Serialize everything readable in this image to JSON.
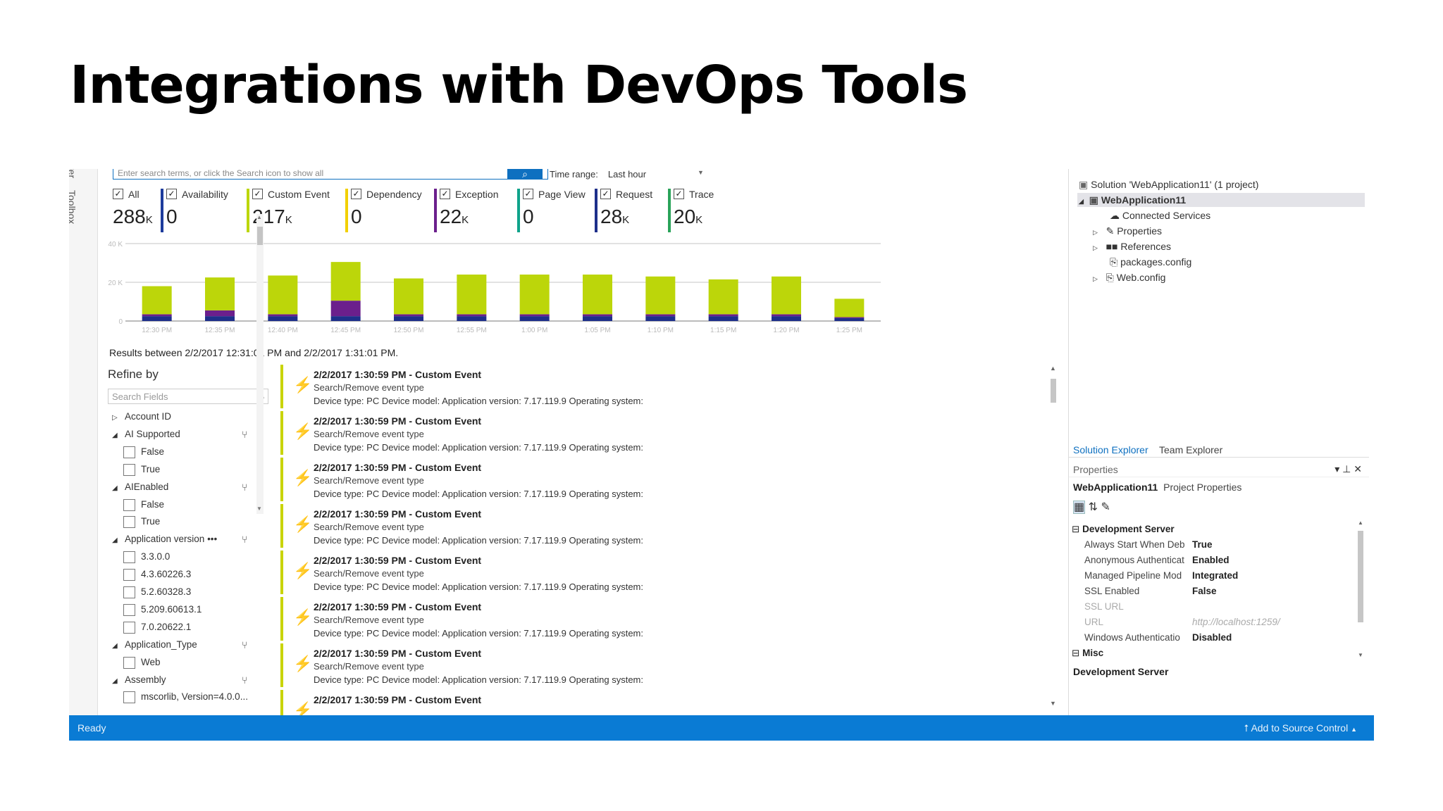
{
  "slide": {
    "title": "Integrations with DevOps Tools"
  },
  "toolbox": {
    "label": "Toolbox",
    "ref_label": "rer"
  },
  "search": {
    "placeholder": "Enter search terms, or click the Search icon to show all",
    "button_icon": "search-icon"
  },
  "time_range": {
    "label": "Time range:",
    "value": "Last hour"
  },
  "filters": [
    {
      "label": "All",
      "count": "288",
      "unit": "K",
      "color": "#ffffff",
      "checked": true
    },
    {
      "label": "Availability",
      "count": "0",
      "unit": "",
      "color": "#1d3b9c",
      "checked": true
    },
    {
      "label": "Custom Event",
      "count": "217",
      "unit": "K",
      "color": "#bcd60a",
      "checked": true
    },
    {
      "label": "Dependency",
      "count": "0",
      "unit": "",
      "color": "#f2d000",
      "checked": true
    },
    {
      "label": "Exception",
      "count": "22",
      "unit": "K",
      "color": "#6b1f8c",
      "checked": true
    },
    {
      "label": "Page View",
      "count": "0",
      "unit": "",
      "color": "#0fa38a",
      "checked": true
    },
    {
      "label": "Request",
      "count": "28",
      "unit": "K",
      "color": "#1e2f8a",
      "checked": true
    },
    {
      "label": "Trace",
      "count": "20",
      "unit": "K",
      "color": "#2aa35a",
      "checked": true
    }
  ],
  "chart_data": {
    "type": "bar",
    "ylim": [
      0,
      40000
    ],
    "ytick_labels": [
      "40 K",
      "20 K",
      "0"
    ],
    "categories": [
      "12:30 PM",
      "12:35 PM",
      "12:40 PM",
      "12:45 PM",
      "12:50 PM",
      "12:55 PM",
      "1:00 PM",
      "1:05 PM",
      "1:10 PM",
      "1:15 PM",
      "1:20 PM",
      "1:25 PM"
    ],
    "series": [
      {
        "name": "Request",
        "color": "#1e2f8a",
        "values": [
          2500,
          2500,
          2500,
          2500,
          2500,
          2500,
          2500,
          2500,
          2500,
          2500,
          2500,
          1500
        ]
      },
      {
        "name": "Exception",
        "color": "#6b1f8c",
        "values": [
          1000,
          3000,
          1000,
          8000,
          1000,
          1000,
          1000,
          1000,
          1000,
          1000,
          1000,
          500
        ]
      },
      {
        "name": "Custom Event",
        "color": "#bcd60a",
        "values": [
          14500,
          17000,
          20000,
          20000,
          18500,
          20500,
          20500,
          20500,
          19500,
          18000,
          19500,
          9500
        ]
      }
    ],
    "grid": true
  },
  "results_text": "Results between 2/2/2017 12:31:01 PM and 2/2/2017 1:31:01 PM.",
  "refine": {
    "title": "Refine by",
    "search_placeholder": "Search Fields",
    "rows": [
      {
        "type": "group",
        "arrow": "▷",
        "label": "Account ID",
        "filter": false
      },
      {
        "type": "group",
        "arrow": "◢",
        "label": "AI Supported",
        "filter": true
      },
      {
        "type": "item",
        "label": "False"
      },
      {
        "type": "item",
        "label": "True"
      },
      {
        "type": "group",
        "arrow": "◢",
        "label": "AIEnabled",
        "filter": true
      },
      {
        "type": "item",
        "label": "False"
      },
      {
        "type": "item",
        "label": "True"
      },
      {
        "type": "group",
        "arrow": "◢",
        "label": "Application version  •••",
        "filter": true
      },
      {
        "type": "item",
        "label": "3.3.0.0"
      },
      {
        "type": "item",
        "label": "4.3.60226.3"
      },
      {
        "type": "item",
        "label": "5.2.60328.3"
      },
      {
        "type": "item",
        "label": "5.209.60613.1"
      },
      {
        "type": "item",
        "label": "7.0.20622.1"
      },
      {
        "type": "group",
        "arrow": "◢",
        "label": "Application_Type",
        "filter": true
      },
      {
        "type": "item",
        "label": "Web"
      },
      {
        "type": "group",
        "arrow": "◢",
        "label": "Assembly",
        "filter": true
      },
      {
        "type": "item",
        "label": "mscorlib, Version=4.0.0..."
      }
    ]
  },
  "events": [
    {
      "title": "2/2/2017 1:30:59 PM - Custom Event",
      "line2": "Search/Remove event type",
      "line3": "Device type: PC Device model:  Application version: 7.17.119.9 Operating system:"
    },
    {
      "title": "2/2/2017 1:30:59 PM - Custom Event",
      "line2": "Search/Remove event type",
      "line3": "Device type: PC Device model:  Application version: 7.17.119.9 Operating system:"
    },
    {
      "title": "2/2/2017 1:30:59 PM - Custom Event",
      "line2": "Search/Remove event type",
      "line3": "Device type: PC Device model:  Application version: 7.17.119.9 Operating system:"
    },
    {
      "title": "2/2/2017 1:30:59 PM - Custom Event",
      "line2": "Search/Remove event type",
      "line3": "Device type: PC Device model:  Application version: 7.17.119.9 Operating system:"
    },
    {
      "title": "2/2/2017 1:30:59 PM - Custom Event",
      "line2": "Search/Remove event type",
      "line3": "Device type: PC Device model:  Application version: 7.17.119.9 Operating system:"
    },
    {
      "title": "2/2/2017 1:30:59 PM - Custom Event",
      "line2": "Search/Remove event type",
      "line3": "Device type: PC Device model:  Application version: 7.17.119.9 Operating system:"
    },
    {
      "title": "2/2/2017 1:30:59 PM - Custom Event",
      "line2": "Search/Remove event type",
      "line3": "Device type: PC Device model:  Application version: 7.17.119.9 Operating system:"
    },
    {
      "title": "2/2/2017 1:30:59 PM - Custom Event",
      "line2": "",
      "line3": ""
    }
  ],
  "solution_explorer": {
    "solution": "Solution 'WebApplication11' (1 project)",
    "project": "WebApplication11",
    "items": [
      "Connected Services",
      "Properties",
      "References",
      "packages.config",
      "Web.config"
    ],
    "tabs": [
      "Solution Explorer",
      "Team Explorer"
    ]
  },
  "properties": {
    "header": "Properties",
    "header_controls": "▾ ⊥ ✕",
    "subject": "WebApplication11",
    "subject_type": "Project Properties",
    "group1": "Development Server",
    "rows": [
      {
        "name": "Always Start When Deb",
        "value": "True",
        "dim": false
      },
      {
        "name": "Anonymous Authenticat",
        "value": "Enabled",
        "dim": false
      },
      {
        "name": "Managed Pipeline Mod",
        "value": "Integrated",
        "dim": false
      },
      {
        "name": "SSL Enabled",
        "value": "False",
        "dim": false
      },
      {
        "name": "SSL URL",
        "value": "",
        "dim": true
      },
      {
        "name": "URL",
        "value": "http://localhost:1259/",
        "dim": true
      },
      {
        "name": "Windows Authenticatio",
        "value": "Disabled",
        "dim": false
      }
    ],
    "group2": "Misc",
    "description": "Development Server"
  },
  "status": {
    "ready": "Ready",
    "source_control": "Add to Source Control"
  }
}
